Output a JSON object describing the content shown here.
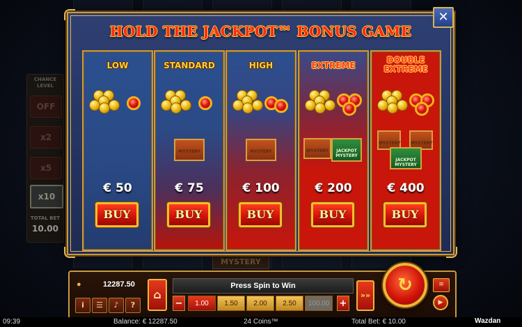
{
  "modal": {
    "title": "HOLD THE JACKPOT™ BONUS GAME",
    "close_icon": "✕",
    "tiers": [
      {
        "name": "LOW",
        "price": "€ 50",
        "buy_label": "BUY",
        "coins": 6,
        "gems": 1,
        "chests": []
      },
      {
        "name": "STANDARD",
        "price": "€ 75",
        "buy_label": "BUY",
        "coins": 6,
        "gems": 1,
        "chests": [
          {
            "label": "MYSTERY",
            "color": "orange"
          }
        ]
      },
      {
        "name": "HIGH",
        "price": "€ 100",
        "buy_label": "BUY",
        "coins": 6,
        "gems": 2,
        "chests": [
          {
            "label": "MYSTERY",
            "color": "orange"
          }
        ]
      },
      {
        "name": "EXTREME",
        "price": "€ 200",
        "buy_label": "BUY",
        "coins": 6,
        "gems": 3,
        "chests": [
          {
            "label": "MYSTERY",
            "color": "orange"
          },
          {
            "label": "JACKPOT MYSTERY",
            "color": "green"
          }
        ]
      },
      {
        "name": "DOUBLE EXTREME",
        "price": "€ 400",
        "buy_label": "BUY",
        "coins": 6,
        "gems": 3,
        "chests": [
          {
            "label": "MYSTERY",
            "color": "orange"
          },
          {
            "label": "MYSTERY",
            "color": "orange"
          },
          {
            "label": "JACKPOT MYSTERY",
            "color": "green"
          }
        ]
      }
    ],
    "tier_colors": {
      "blue_top": "#2e4a86",
      "red": "#c8160a",
      "gold": "#ffcf3a",
      "red_text": "#ff3b22"
    }
  },
  "chance_panel": {
    "title": "CHANCE LEVEL",
    "options": [
      "OFF",
      "x2",
      "x5",
      "x10"
    ],
    "selected": "x10",
    "total_bet_label": "TOTAL BET",
    "total_bet_value": "10.00"
  },
  "background": {
    "mystery_text": "MYSTERY"
  },
  "controls": {
    "balance_value": "12287.50",
    "status_message": "Press Spin to Win",
    "bet_options": [
      "1.00",
      "1.50",
      "2.00",
      "2.50",
      "100.00"
    ],
    "selected_bet": "1.00",
    "minus_label": "−",
    "plus_label": "+",
    "icons": {
      "info": "i",
      "menu": "☰",
      "sound": "♪",
      "help": "?",
      "cart": "🛒",
      "turbo": "»»",
      "spin": "↻",
      "bet_menu": "≡",
      "autoplay": "▶"
    }
  },
  "status_strip": {
    "time": "09:39",
    "balance": "Balance: € 12287.50",
    "coins": "24 Coins™",
    "total_bet": "Total Bet: € 10.00",
    "logo": "Wazdan"
  }
}
